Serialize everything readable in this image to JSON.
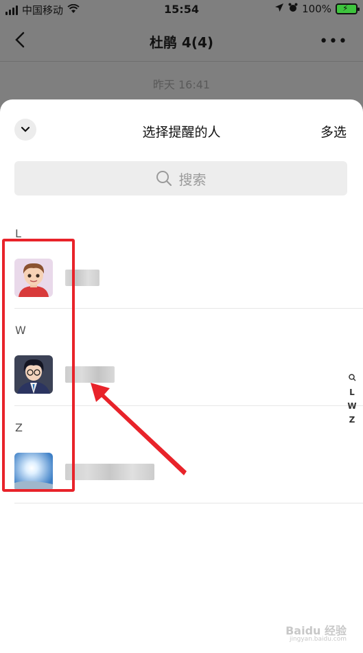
{
  "status_bar": {
    "carrier": "中国移动",
    "time": "15:54",
    "battery": "100%"
  },
  "chat": {
    "title": "杜鹃 4(4)",
    "timestamp": "昨天 16:41"
  },
  "sheet": {
    "title": "选择提醒的人",
    "multi_select": "多选",
    "search_placeholder": "搜索"
  },
  "sections": [
    {
      "letter": "L"
    },
    {
      "letter": "W"
    },
    {
      "letter": "Z"
    }
  ],
  "index_bar": [
    "L",
    "W",
    "Z"
  ],
  "watermark": {
    "brand": "Baidu 经验",
    "url": "jingyan.baidu.com"
  },
  "colors": {
    "highlight": "#e8232a",
    "sheet_bg": "#ffffff",
    "overlay": "#7f7f7f"
  }
}
